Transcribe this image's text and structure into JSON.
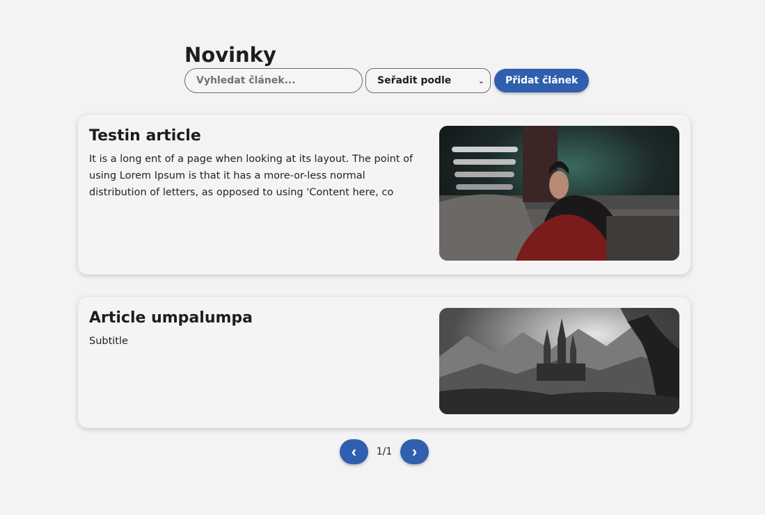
{
  "header": {
    "title": "Novinky",
    "search_placeholder": "Vyhledat článek...",
    "sort_label": "Seřadit podle",
    "add_button": "Přidat článek"
  },
  "articles": [
    {
      "title": "Testin article",
      "body": "It is a long ent of a page when looking at its layout. The point of using Lorem Ipsum is that it has a more-or-less normal distribution of letters, as opposed to using 'Content here, co"
    },
    {
      "title": "Article umpalumpa",
      "body": "Subtitle"
    }
  ],
  "pagination": {
    "prev": "‹",
    "next": "›",
    "page_indicator": "1/1"
  },
  "colors": {
    "accent": "#2f5fae",
    "background": "#f3f3f3",
    "card": "#f4f4f4"
  }
}
